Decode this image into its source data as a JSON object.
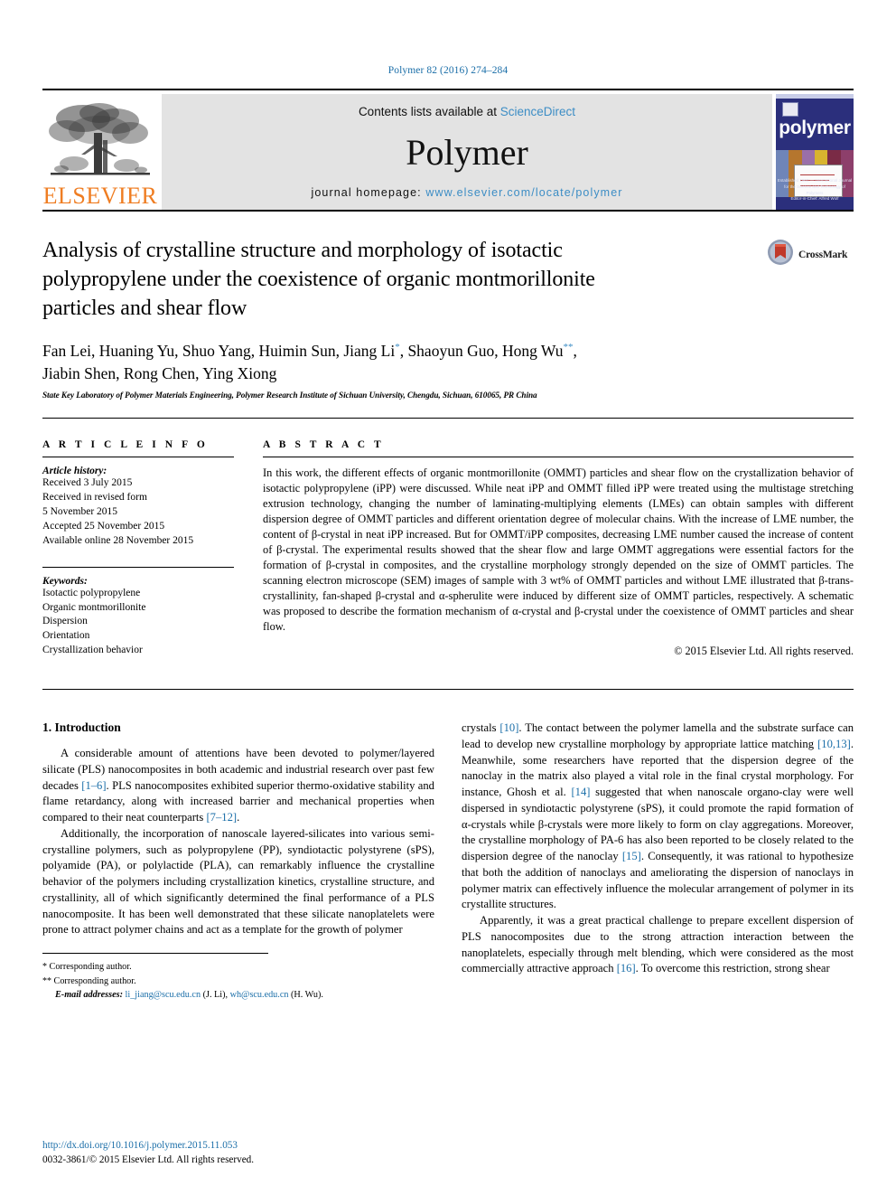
{
  "running_head": "Polymer 82 (2016) 274–284",
  "masthead": {
    "publisher_name": "ELSEVIER",
    "contents_prefix": "Contents lists available at ",
    "contents_link": "ScienceDirect",
    "journal_name": "Polymer",
    "homepage_prefix": "journal homepage: ",
    "homepage_url": "www.elsevier.com/locate/polymer",
    "cover_title": "polymer",
    "cover_footer_line1": "Established 1960 — International Journal for the Science and Technology of Polymers",
    "cover_footer_line2": "Editor-in-Chief: Alfred Wolf"
  },
  "article": {
    "title": "Analysis of crystalline structure and morphology of isotactic polypropylene under the coexistence of organic montmorillonite particles and shear flow",
    "crossmark_label": "CrossMark",
    "authors_line1": "Fan Lei, Huaning Yu, Shuo Yang, Huimin Sun, Jiang Li",
    "authors_line1_sup1": "*",
    "authors_line1_mid": ", Shaoyun Guo, Hong Wu",
    "authors_line1_sup2": "**",
    "authors_line1_end": ",",
    "authors_line2": "Jiabin Shen, Rong Chen, Ying Xiong",
    "affiliation": "State Key Laboratory of Polymer Materials Engineering, Polymer Research Institute of Sichuan University, Chengdu, Sichuan, 610065, PR China"
  },
  "article_info": {
    "heading": "A R T I C L E   I N F O",
    "history_label": "Article history:",
    "history_lines": [
      "Received 3 July 2015",
      "Received in revised form",
      "5 November 2015",
      "Accepted 25 November 2015",
      "Available online 28 November 2015"
    ],
    "keywords_label": "Keywords:",
    "keywords": [
      "Isotactic polypropylene",
      "Organic montmorillonite",
      "Dispersion",
      "Orientation",
      "Crystallization behavior"
    ]
  },
  "abstract": {
    "heading": "A B S T R A C T",
    "text": "In this work, the different effects of organic montmorillonite (OMMT) particles and shear flow on the crystallization behavior of isotactic polypropylene (iPP) were discussed. While neat iPP and OMMT filled iPP were treated using the multistage stretching extrusion technology, changing the number of laminating-multiplying elements (LMEs) can obtain samples with different dispersion degree of OMMT particles and different orientation degree of molecular chains. With the increase of LME number, the content of β-crystal in neat iPP increased. But for OMMT/iPP composites, decreasing LME number caused the increase of content of β-crystal. The experimental results showed that the shear flow and large OMMT aggregations were essential factors for the formation of β-crystal in composites, and the crystalline morphology strongly depended on the size of OMMT particles. The scanning electron microscope (SEM) images of sample with 3 wt% of OMMT particles and without LME illustrated that β-trans-crystallinity, fan-shaped β-crystal and α-spherulite were induced by different size of OMMT particles, respectively. A schematic was proposed to describe the formation mechanism of α-crystal and β-crystal under the coexistence of OMMT particles and shear flow.",
    "copyright": "© 2015 Elsevier Ltd. All rights reserved."
  },
  "introduction": {
    "heading": "1. Introduction",
    "left_paragraphs": [
      {
        "pre": "A considerable amount of attentions have been devoted to polymer/layered silicate (PLS) nanocomposites in both academic and industrial research over past few decades ",
        "ref1": "[1–6]",
        "mid": ". PLS nanocomposites exhibited superior thermo-oxidative stability and flame retardancy, along with increased barrier and mechanical properties when compared to their neat counterparts ",
        "ref2": "[7–12]",
        "post": "."
      },
      {
        "pre": "Additionally, the incorporation of nanoscale layered-silicates into various semi-crystalline polymers, such as polypropylene (PP), syndiotactic polystyrene (sPS), polyamide (PA), or polylactide (PLA), can remarkably influence the crystalline behavior of the polymers including crystallization kinetics, crystalline structure, and crystallinity, all of which significantly determined the final performance of a PLS nanocomposite. It has been well demonstrated that these silicate nanoplatelets were prone to attract polymer chains and act as a template for the growth of polymer",
        "ref1": "",
        "mid": "",
        "ref2": "",
        "post": ""
      }
    ],
    "right_paragraph_1": {
      "pre": "crystals ",
      "ref1": "[10]",
      "mid1": ". The contact between the polymer lamella and the substrate surface can lead to develop new crystalline morphology by appropriate lattice matching ",
      "ref2": "[10,13]",
      "mid2": ". Meanwhile, some researchers have reported that the dispersion degree of the nanoclay in the matrix also played a vital role in the final crystal morphology. For instance, Ghosh et al. ",
      "ref3": "[14]",
      "mid3": " suggested that when nanoscale organo-clay were well dispersed in syndiotactic polystyrene (sPS), it could promote the rapid formation of α-crystals while β-crystals were more likely to form on clay aggregations. Moreover, the crystalline morphology of PA-6 has also been reported to be closely related to the dispersion degree of the nanoclay ",
      "ref4": "[15]",
      "post": ". Consequently, it was rational to hypothesize that both the addition of nanoclays and ameliorating the dispersion of nanoclays in polymer matrix can effectively influence the molecular arrangement of polymer in its crystallite structures."
    },
    "right_paragraph_2": {
      "pre": "Apparently, it was a great practical challenge to prepare excellent dispersion of PLS nanocomposites due to the strong attraction interaction between the nanoplatelets, especially through melt blending, which were considered as the most commercially attractive approach ",
      "ref1": "[16]",
      "post": ". To overcome this restriction, strong shear"
    }
  },
  "footnotes": {
    "corresponding_1_mark": "*",
    "corresponding_1": "Corresponding author.",
    "corresponding_2_mark": "**",
    "corresponding_2": "Corresponding author.",
    "emails_label": "E-mail addresses:",
    "email_1": "li_jiang@scu.edu.cn",
    "email_1_owner": "(J. Li),",
    "email_2": "wh@scu.edu.cn",
    "email_2_owner": "(H. Wu)."
  },
  "page_footer": {
    "doi": "http://dx.doi.org/10.1016/j.polymer.2015.11.053",
    "issn_line": "0032-3861/© 2015 Elsevier Ltd. All rights reserved."
  },
  "colors": {
    "link": "#1a6ea8",
    "elsevier_orange": "#ef7d22",
    "cover_blue": "#2b2f7c",
    "masthead_gray": "#e3e3e3"
  }
}
